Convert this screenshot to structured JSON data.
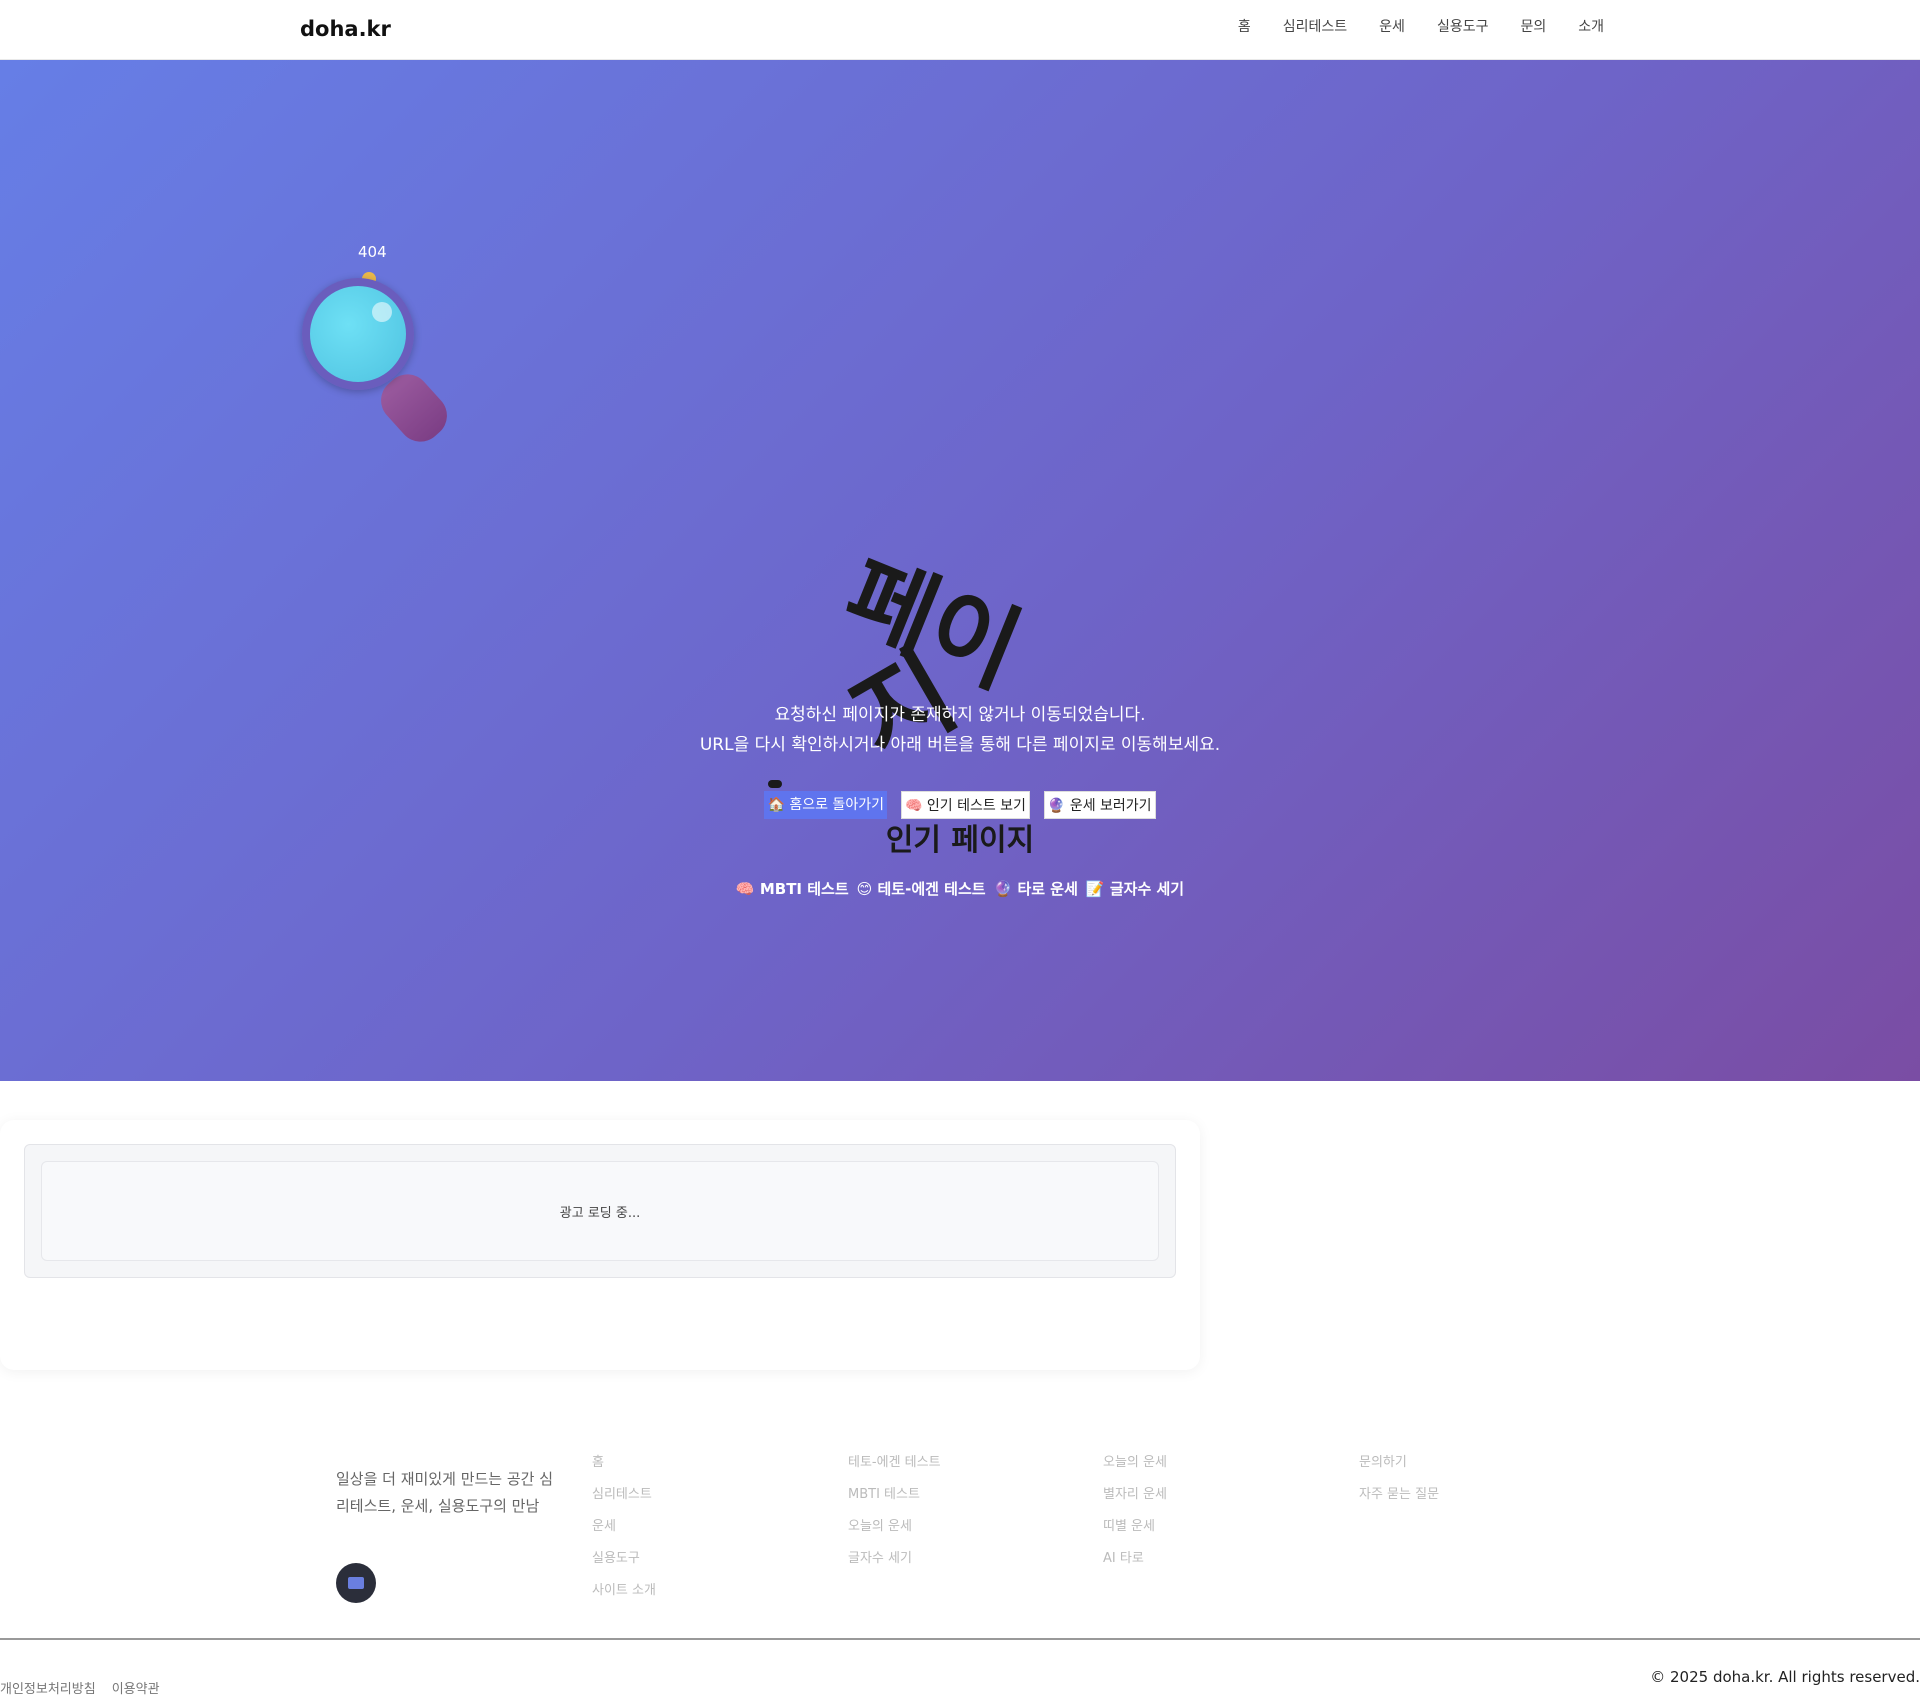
{
  "header": {
    "logo": "doha.kr",
    "nav": [
      "홈",
      "심리테스트",
      "운세",
      "실용도구",
      "문의",
      "소개"
    ]
  },
  "hero": {
    "code": "404",
    "glyph_1": "페이",
    "glyph_2": "지",
    "desc_line_1": "요청하신 페이지가 존재하지 않거나 이동되었습니다.",
    "desc_line_2": "URL을 다시 확인하시거나 아래 버튼을 통해 다른 페이지로 이동해보세요.",
    "buttons": [
      {
        "icon": "🏠",
        "label": "홈으로 돌아가기"
      },
      {
        "icon": "🧠",
        "label": "인기 테스트 보기"
      },
      {
        "icon": "🔮",
        "label": "운세 보러가기"
      }
    ],
    "popular_title": "인기 페이지",
    "popular": [
      {
        "icon": "🧠",
        "label": "MBTI 테스트"
      },
      {
        "icon": "😊",
        "label": "테토-에겐 테스트"
      },
      {
        "icon": "🔮",
        "label": "타로 운세"
      },
      {
        "icon": "📝",
        "label": "글자수 세기"
      }
    ]
  },
  "ad": {
    "loading": "광고 로딩 중..."
  },
  "footer": {
    "tagline": "일상을 더 재미있게 만드는 공간 심리테스트, 운세, 실용도구의 만남",
    "col_1": [
      "홈",
      "심리테스트",
      "운세",
      "실용도구",
      "사이트 소개"
    ],
    "col_2": [
      "테토-에겐 테스트",
      "MBTI 테스트",
      "오늘의 운세",
      "글자수 세기"
    ],
    "col_3": [
      "오늘의 운세",
      "별자리 운세",
      "띠별 운세",
      "AI 타로"
    ],
    "col_4": [
      "문의하기",
      "자주 묻는 질문"
    ],
    "legal": [
      "개인정보처리방침",
      "이용약관"
    ],
    "copyright": "© 2025 doha.kr. All rights reserved."
  }
}
